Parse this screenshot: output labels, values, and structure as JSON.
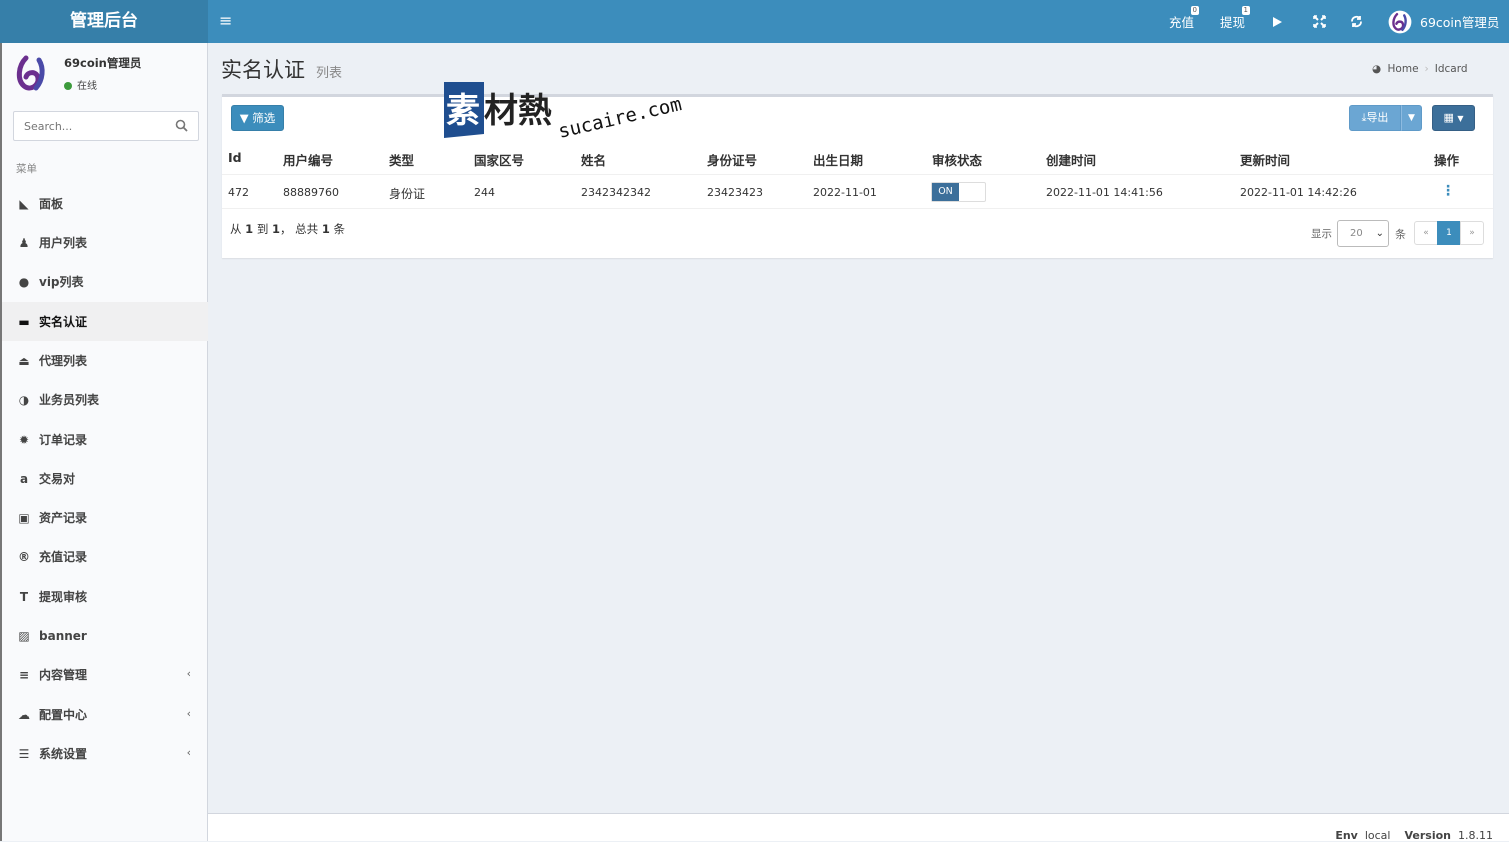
{
  "app": {
    "title": "管理后台"
  },
  "header": {
    "recharge": {
      "label": "充值",
      "badge": "0"
    },
    "withdraw": {
      "label": "提现",
      "badge": "1"
    },
    "user": "69coin管理员"
  },
  "sidebar": {
    "user": {
      "name": "69coin管理员",
      "status": "在线"
    },
    "search_placeholder": "Search...",
    "menu_header": "菜单",
    "items": [
      {
        "label": "面板",
        "icon": "area-chart-icon"
      },
      {
        "label": "用户列表",
        "icon": "user-icon"
      },
      {
        "label": "vip列表",
        "icon": "chevron-circle-down-icon"
      },
      {
        "label": "实名认证",
        "icon": "credit-card-icon",
        "active": true
      },
      {
        "label": "代理列表",
        "icon": "eject-circle-icon"
      },
      {
        "label": "业务员列表",
        "icon": "adjust-icon"
      },
      {
        "label": "订单记录",
        "icon": "gear-icon"
      },
      {
        "label": "交易对",
        "icon": "amazon-icon"
      },
      {
        "label": "资产记录",
        "icon": "money-icon"
      },
      {
        "label": "充值记录",
        "icon": "registered-icon"
      },
      {
        "label": "提现审核",
        "icon": "text-height-icon"
      },
      {
        "label": "banner",
        "icon": "image-icon"
      },
      {
        "label": "内容管理",
        "icon": "bars-icon",
        "expandable": true
      },
      {
        "label": "配置中心",
        "icon": "cloud-icon",
        "expandable": true
      },
      {
        "label": "系统设置",
        "icon": "server-icon",
        "expandable": true
      }
    ]
  },
  "page": {
    "title": "实名认证",
    "subtitle": "列表",
    "breadcrumb": {
      "home": "Home",
      "current": "Idcard"
    }
  },
  "toolbar": {
    "filter_label": "筛选",
    "export_label": "导出"
  },
  "table": {
    "headers": [
      "Id",
      "用户编号",
      "类型",
      "国家区号",
      "姓名",
      "身份证号",
      "出生日期",
      "审核状态",
      "创建时间",
      "更新时间",
      "操作"
    ],
    "rows": [
      {
        "id": "472",
        "user_no": "88889760",
        "type": "身份证",
        "country_code": "244",
        "name": "2342342342",
        "id_number": "23423423",
        "birth": "2022-11-01",
        "status": "ON",
        "created": "2022-11-01 14:41:56",
        "updated": "2022-11-01 14:42:26"
      }
    ]
  },
  "pagination": {
    "from": "1",
    "to": "1",
    "total": "1",
    "summary_parts": [
      "从 ",
      "1",
      " 到 ",
      "1",
      "， 总共 ",
      "1",
      " 条"
    ],
    "show_label": "显示",
    "per_page": "20",
    "unit": "条",
    "prev": "«",
    "current": "1",
    "next": "»"
  },
  "watermark": {
    "text": "素材熱 sucaire.com"
  },
  "footer": {
    "env_label": "Env",
    "env": "local",
    "version_label": "Version",
    "version": "1.8.11"
  },
  "colors": {
    "primary": "#3c8dbc",
    "header": "#3c8dbc",
    "logo_bg": "#367fa9",
    "online": "#3c9a3c"
  }
}
